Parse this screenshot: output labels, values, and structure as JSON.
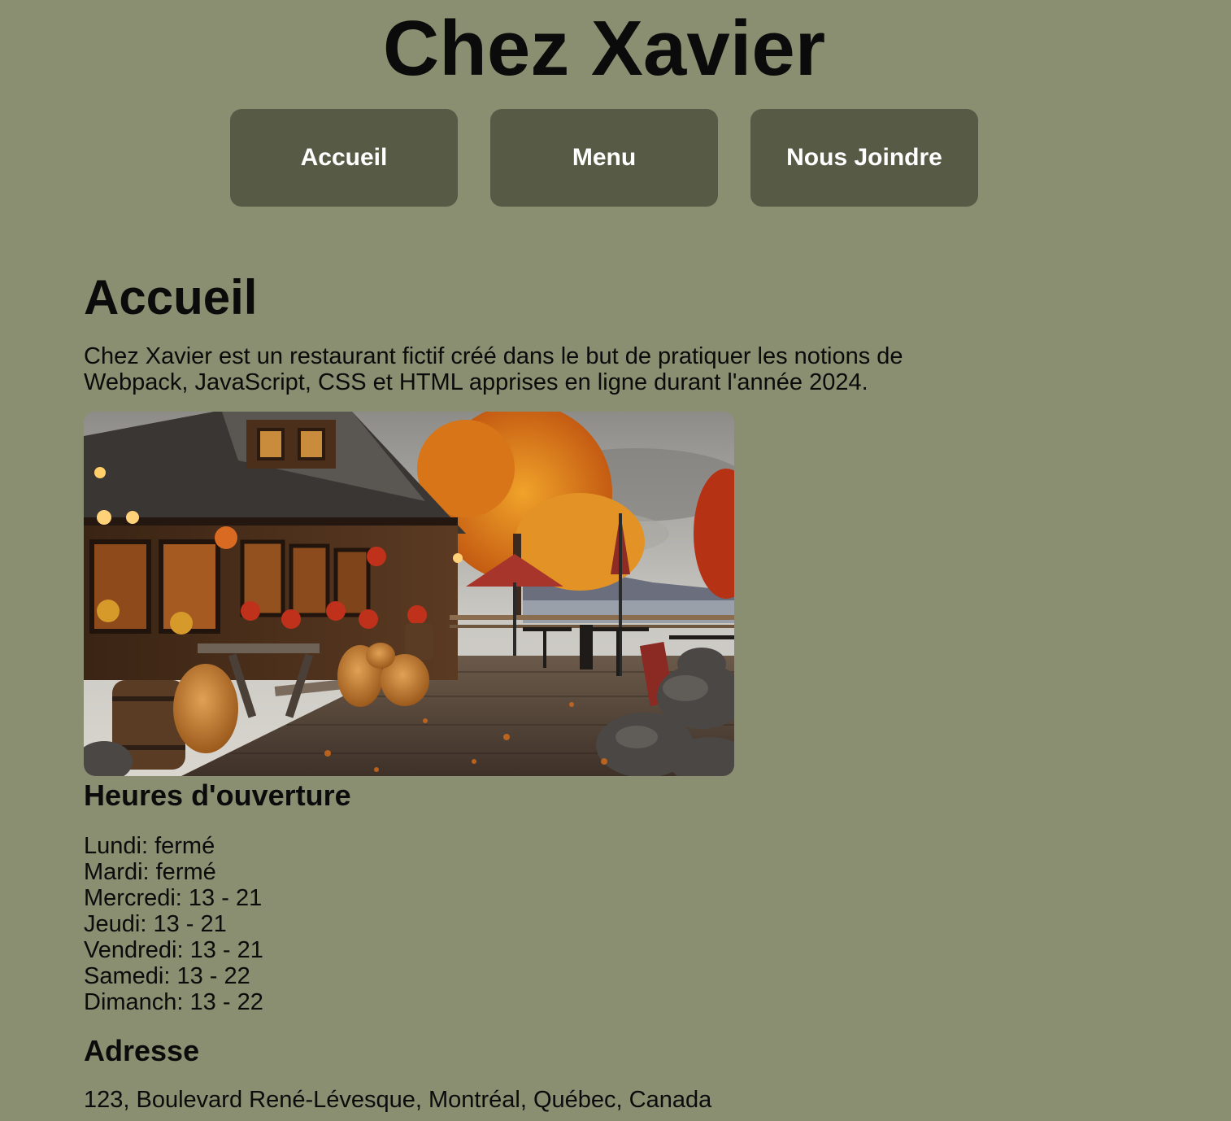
{
  "header": {
    "title": "Chez Xavier"
  },
  "nav": {
    "items": [
      {
        "label": "Accueil"
      },
      {
        "label": "Menu"
      },
      {
        "label": "Nous Joindre"
      }
    ]
  },
  "main": {
    "heading": "Accueil",
    "intro_line_1": "Chez Xavier est un restaurant fictif créé dans le but de pratiquer les notions de",
    "intro_line_2": "Webpack, JavaScript, CSS et HTML apprises en ligne durant l'année 2024.",
    "hours": {
      "title": "Heures d'ouverture",
      "lines": [
        "Lundi: fermé",
        "Mardi: fermé",
        "Mercredi: 13 - 21",
        "Jeudi: 13 - 21",
        "Vendredi: 13 - 21",
        "Samedi: 13 - 22",
        "Dimanch: 13 - 22"
      ]
    },
    "address": {
      "title": "Adresse",
      "text": "123, Boulevard René-Lévesque, Montréal, Québec, Canada"
    }
  },
  "colors": {
    "background": "#8a8f71",
    "nav_button": "#575b46",
    "nav_text": "#ffffff",
    "text": "#0b0b0b"
  }
}
